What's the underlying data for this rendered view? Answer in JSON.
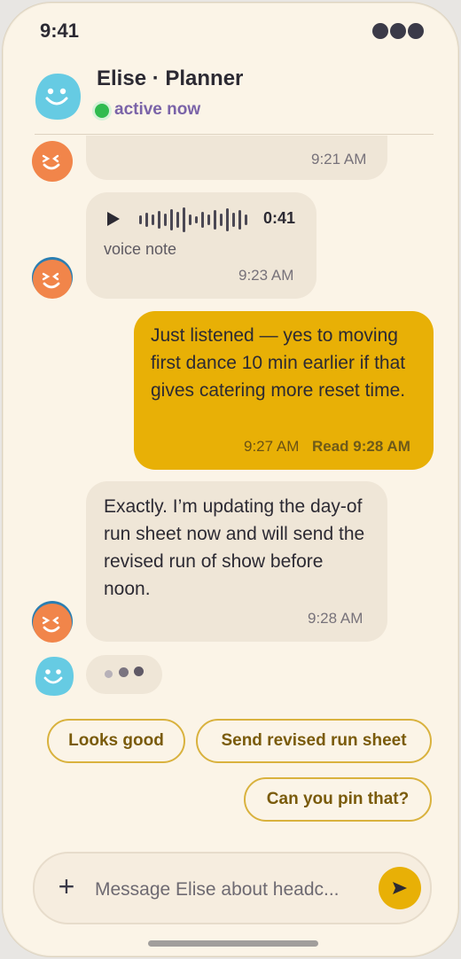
{
  "status_bar": {
    "time": "9:41"
  },
  "header": {
    "name": "Elise · Planner",
    "status": "active now"
  },
  "messages": [
    {
      "time": "9:21 AM"
    },
    {
      "kind": "voice",
      "duration": "0:41",
      "caption": "voice note",
      "time": "9:23 AM"
    },
    {
      "text": "Just listened — yes to moving first dance 10 min earlier if that gives catering more reset time.",
      "time": "9:27 AM",
      "read": "Read 9:28 AM"
    },
    {
      "text": "Exactly. I’m updating the day-of run sheet now and will send the revised run of show before noon.",
      "time": "9:28 AM"
    }
  ],
  "quick_replies": [
    "Looks good",
    "Send revised run sheet",
    "Can you pin that?"
  ],
  "composer": {
    "placeholder": "Message Elise about headc..."
  },
  "icons": {
    "add": "plus-icon",
    "send": "send-icon",
    "play": "play-icon",
    "status": "more-dots-icon"
  },
  "colors": {
    "accent": "#e8b006",
    "online": "#2fbb4f",
    "incoming": "#efe6d7",
    "background": "#fbf4e7"
  }
}
